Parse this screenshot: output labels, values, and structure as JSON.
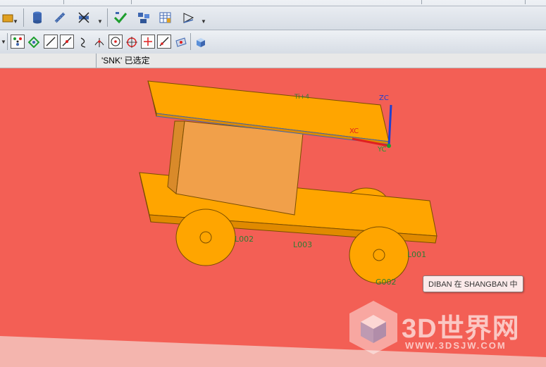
{
  "status": {
    "message": "'SNK' 已选定"
  },
  "toolbar_top": {
    "icons": [
      "folder-icon",
      "database-icon",
      "spring-icon",
      "disable-view-icon",
      "check-icon",
      "assembly-icon",
      "table-icon",
      "view-orient-icon"
    ]
  },
  "toolbar_snap": {
    "icons": [
      "snap-endpoint-icon",
      "snap-control-icon",
      "line-icon",
      "midpoint-icon",
      "curve-icon",
      "intersection-icon",
      "circle-center-icon",
      "quadrant-icon",
      "point-icon",
      "line-point-icon",
      "face-icon",
      "cube-icon"
    ]
  },
  "viewport": {
    "background": "#f35f55",
    "part_color": "#ffa500",
    "component_labels": [
      "L002",
      "L003",
      "L001",
      "G002"
    ],
    "axis_labels": {
      "z": "ZC",
      "x": "XC",
      "y": "YC"
    },
    "top_label": "Ti+4"
  },
  "tooltip": {
    "text": "DIBAN 在 SHANGBAN 中"
  },
  "watermark": {
    "text": "3D世界网",
    "url": "WWW.3DSJW.COM"
  }
}
